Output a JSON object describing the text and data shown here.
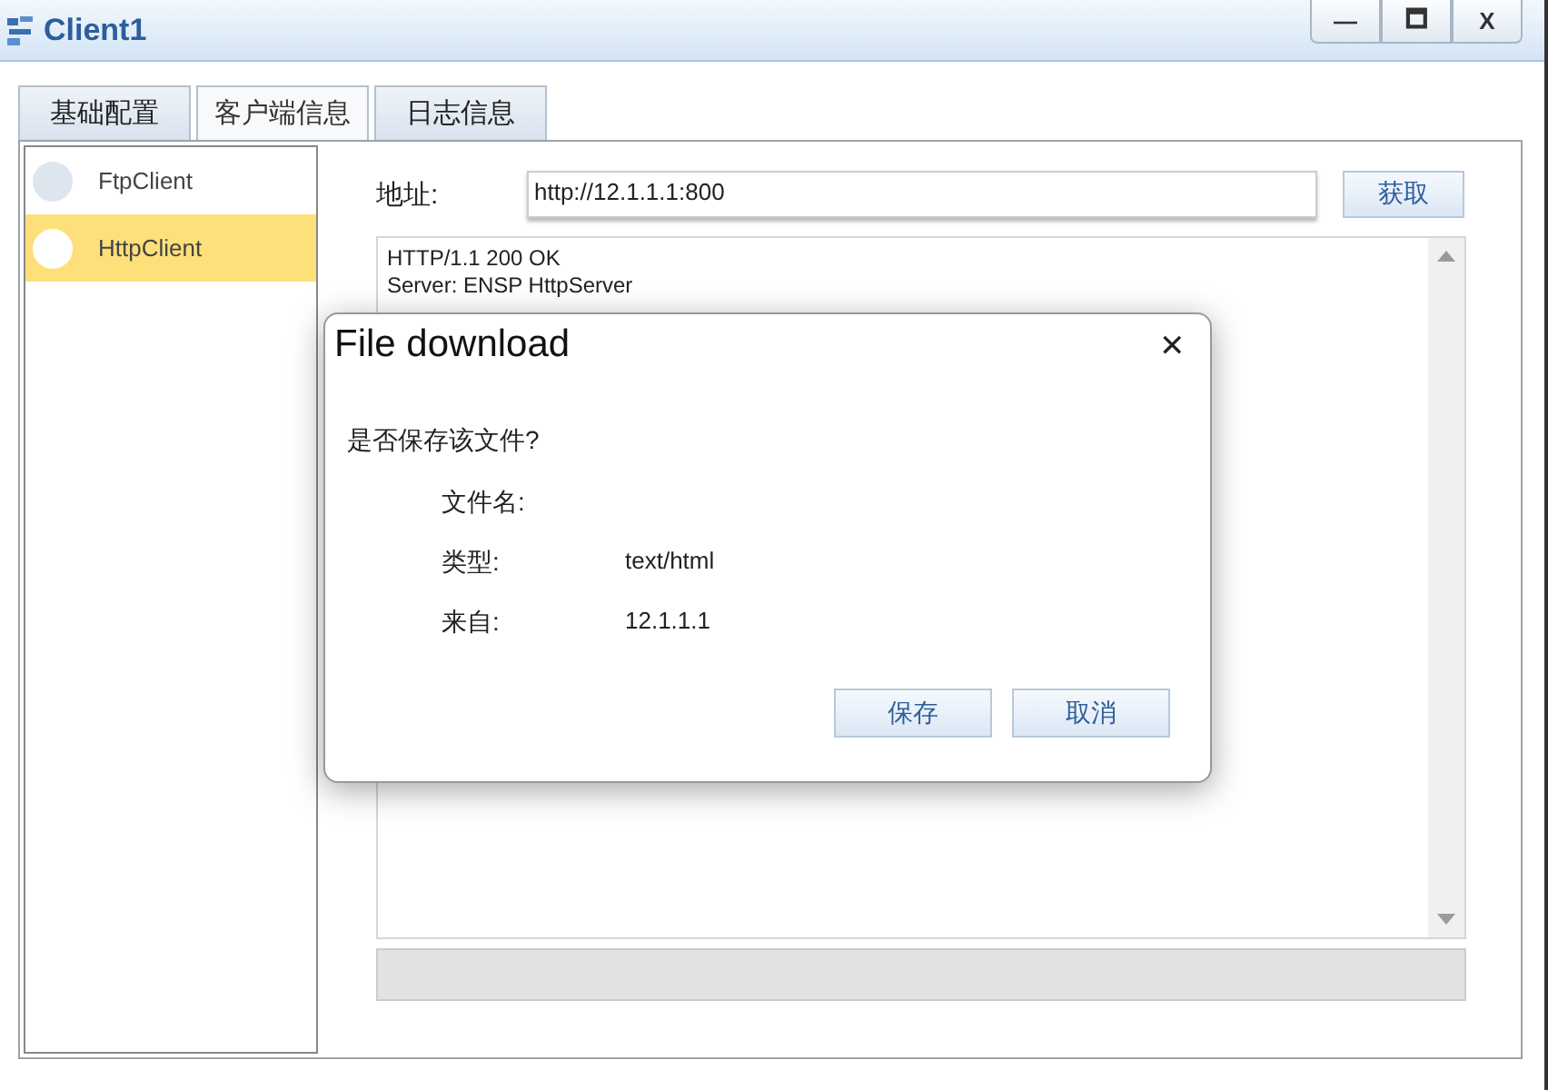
{
  "window": {
    "title": "Client1",
    "controls": [
      "—",
      "🗖",
      "X"
    ]
  },
  "tabs": [
    {
      "label": "基础配置",
      "selected": false
    },
    {
      "label": "客户端信息",
      "selected": true
    },
    {
      "label": "日志信息",
      "selected": false
    }
  ],
  "clients": [
    {
      "label": "FtpClient",
      "selected": false
    },
    {
      "label": "HttpClient",
      "selected": true
    }
  ],
  "address": {
    "label": "地址:",
    "value": "http://12.1.1.1:800",
    "button": "获取"
  },
  "response_lines": [
    "HTTP/1.1 200 OK",
    "Server: ENSP HttpServer"
  ],
  "dialog": {
    "title": "File download",
    "close": "✕",
    "question": "是否保存该文件?",
    "fields": [
      {
        "label": "文件名:"
      },
      {
        "label": "类型:",
        "value": "text/html"
      },
      {
        "label": "来自:",
        "value": "12.1.1.1"
      }
    ],
    "buttons": [
      "保存",
      "取消"
    ]
  }
}
